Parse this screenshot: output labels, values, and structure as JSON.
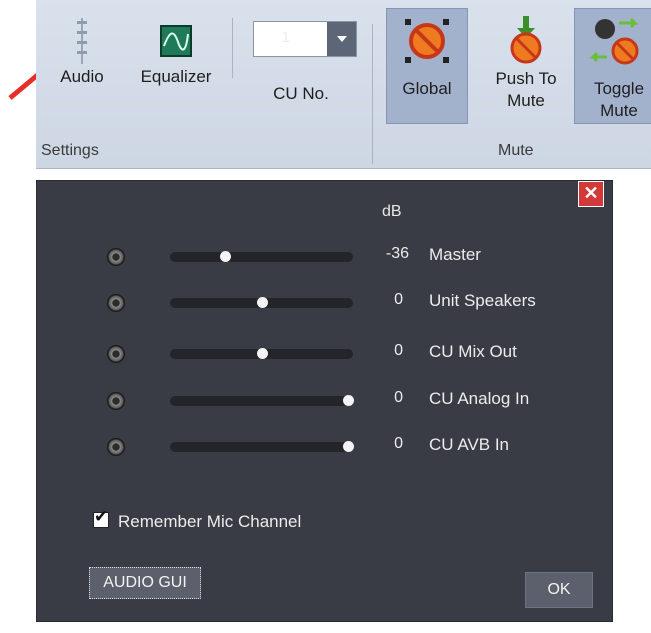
{
  "ribbon": {
    "audio_label": "Audio",
    "equalizer_label": "Equalizer",
    "cu_no_label": "CU No.",
    "cu_no_value": "1",
    "global_label": "Global",
    "push_to_mute_line1": "Push To",
    "push_to_mute_line2": "Mute",
    "toggle_mute_line1": "Toggle",
    "toggle_mute_line2": "Mute",
    "settings_group": "Settings",
    "mute_group": "Mute"
  },
  "dialog": {
    "db_header": "dB",
    "close_symbol": "✕",
    "channels": [
      {
        "label": "Master",
        "value": "-36",
        "level": 0.3
      },
      {
        "label": "Unit Speakers",
        "value": "0",
        "level": 0.5
      },
      {
        "label": "CU Mix Out",
        "value": "0",
        "level": 0.5
      },
      {
        "label": "CU Analog In",
        "value": "0",
        "level": 0.97
      },
      {
        "label": "CU AVB In",
        "value": "0",
        "level": 0.97
      }
    ],
    "remember_mic_channel": "Remember Mic Channel",
    "remember_checked": true,
    "audio_gui_label": "AUDIO GUI",
    "ok_label": "OK"
  },
  "colors": {
    "annotation_arrow": "#e53027",
    "dialog_bg": "#3a3c45",
    "ribbon_bg": "#d3dbe7"
  }
}
